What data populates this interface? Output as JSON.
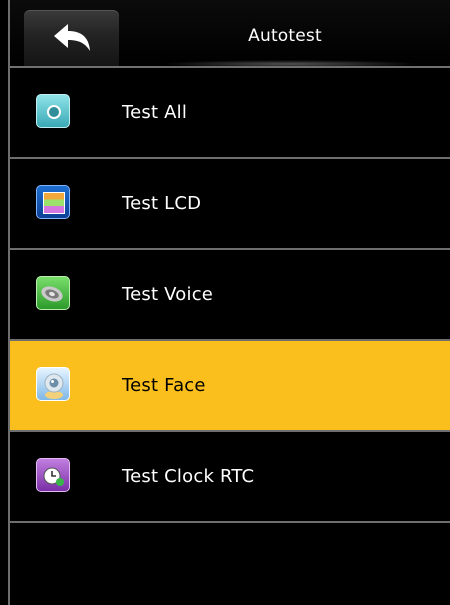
{
  "header": {
    "title": "Autotest",
    "back_icon": "back-arrow-icon"
  },
  "menu": {
    "items": [
      {
        "label": "Test All",
        "icon": "test-all-icon",
        "selected": false
      },
      {
        "label": "Test LCD",
        "icon": "lcd-icon",
        "selected": false
      },
      {
        "label": "Test Voice",
        "icon": "speaker-icon",
        "selected": false
      },
      {
        "label": "Test Face",
        "icon": "face-camera-icon",
        "selected": true
      },
      {
        "label": "Test Clock RTC",
        "icon": "clock-icon",
        "selected": false
      }
    ]
  },
  "colors": {
    "background": "#000000",
    "selected": "#fbbf1d",
    "separator": "#6e6e6e",
    "text": "#ffffff",
    "selected_text": "#000000"
  }
}
